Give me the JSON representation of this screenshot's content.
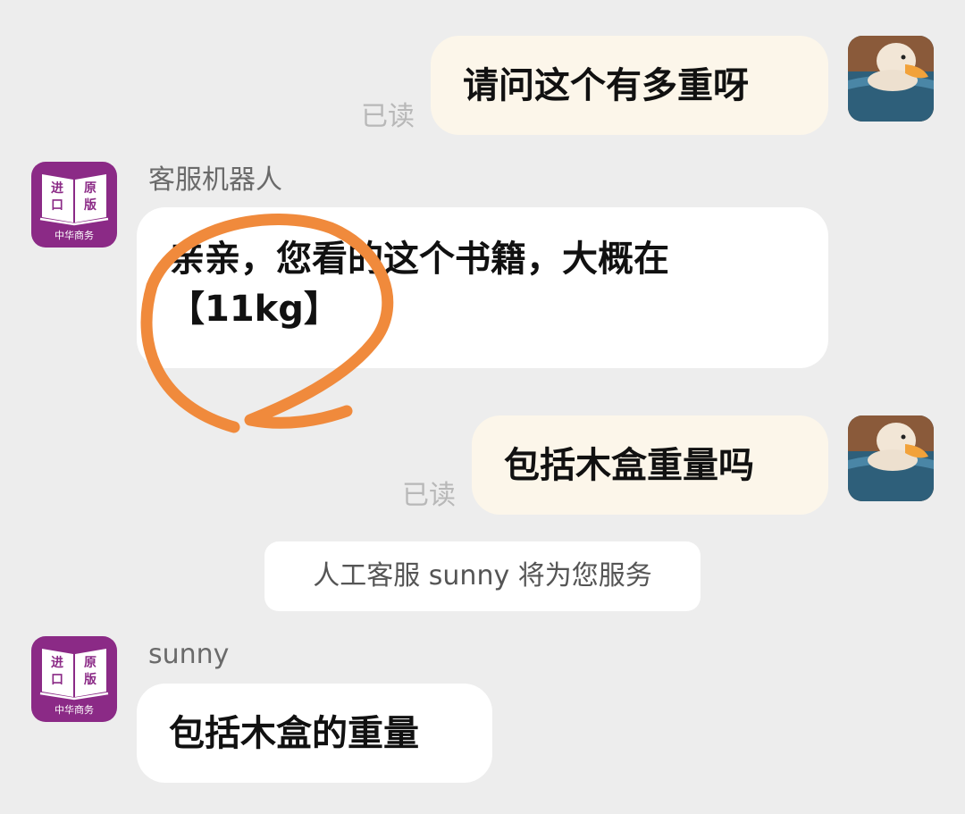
{
  "messages": {
    "m1": {
      "text": "请问这个有多重呀",
      "status": "已读"
    },
    "m2": {
      "sender": "客服机器人",
      "line1": "亲亲，您看的这个书籍，大概在",
      "line2": "【11kg】"
    },
    "m3": {
      "text": "包括木盒重量吗",
      "status": "已读"
    },
    "system": {
      "text": "人工客服 sunny 将为您服务"
    },
    "m4": {
      "sender": "sunny",
      "text": "包括木盒的重量"
    }
  },
  "shop_logo": {
    "top_left": "进",
    "top_right": "原",
    "mid_left": "口",
    "mid_right": "版",
    "bottom": "中华商务"
  },
  "colors": {
    "background": "#ededed",
    "user_bubble": "#fcf6ea",
    "agent_bubble": "#ffffff",
    "shop_logo": "#8b2a86",
    "annotation_circle": "#f08a3c"
  },
  "icons": {
    "user_avatar": "duck-avatar-icon",
    "shop_avatar": "book-logo-icon"
  }
}
